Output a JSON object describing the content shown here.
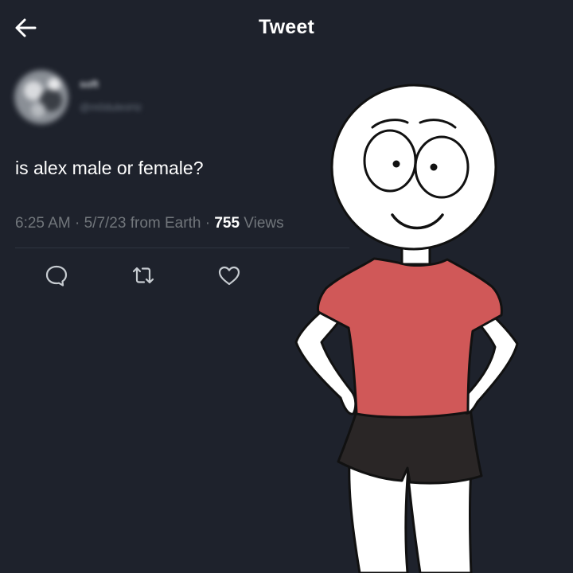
{
  "header": {
    "title": "Tweet",
    "back_icon": "arrow-left-icon"
  },
  "author": {
    "display_name": "soft",
    "handle": "@m0dulesHz"
  },
  "tweet": {
    "text": "is alex male or female?",
    "time": "6:25 AM",
    "date": "5/7/23",
    "source": "from Earth",
    "views_count": "755",
    "views_label": "Views"
  },
  "actions": {
    "reply_icon": "reply-icon",
    "retweet_icon": "retweet-icon",
    "like_icon": "heart-icon"
  },
  "colors": {
    "background": "#1e222c",
    "text": "#ffffff",
    "muted": "#71767b",
    "shirt": "#d05858",
    "shorts": "#2a2626",
    "skin": "#ffffff"
  }
}
